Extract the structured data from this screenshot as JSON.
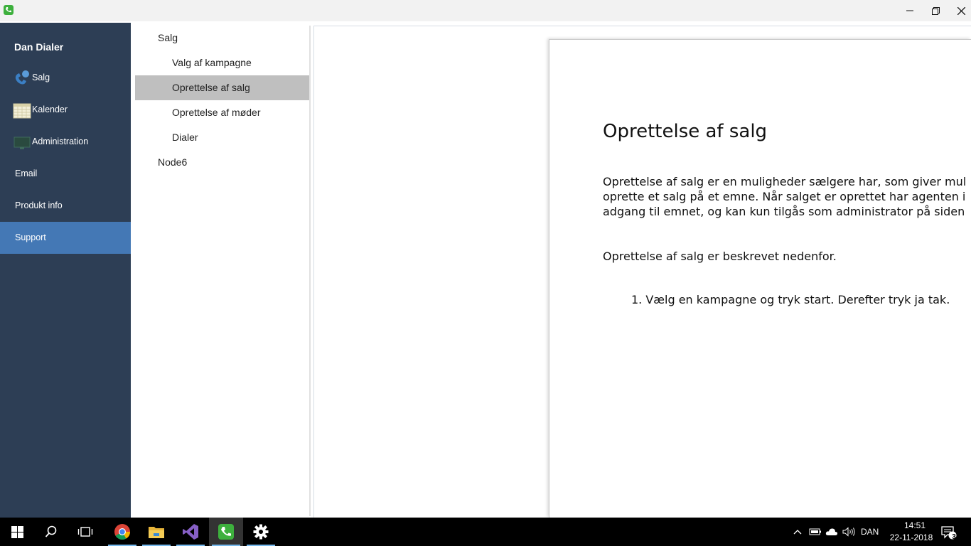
{
  "window": {
    "minimize_glyph": "minimize-icon",
    "maximize_glyph": "restore-icon",
    "close_glyph": "close-icon"
  },
  "sidebar": {
    "title": "Dan Dialer",
    "items": [
      {
        "label": "Salg",
        "icon": "phone-icon"
      },
      {
        "label": "Kalender",
        "icon": "calendar-icon"
      },
      {
        "label": "Administration",
        "icon": "monitor-icon"
      },
      {
        "label": "Email"
      },
      {
        "label": "Produkt info"
      },
      {
        "label": "Support",
        "active": true
      }
    ]
  },
  "tree": {
    "nodes": [
      {
        "label": "Salg",
        "expanded": true
      },
      {
        "label": "Valg af kampagne"
      },
      {
        "label": "Oprettelse af salg",
        "selected": true
      },
      {
        "label": "Oprettelse af møder"
      },
      {
        "label": "Dialer"
      },
      {
        "label": "Node6",
        "expanded": false
      }
    ]
  },
  "document": {
    "heading": "Oprettelse af salg",
    "paragraph_lines": [
      "Oprettelse af salg er en muligheder sælgere har, som giver mul",
      "oprette et salg på et emne. Når salget er oprettet har agenten i",
      "adgang til emnet, og kan kun tilgås som administrator på siden"
    ],
    "intro": "Oprettelse af salg er beskrevet nedenfor.",
    "steps": [
      "1.  Vælg en kampagne og tryk start. Derefter tryk ja tak."
    ]
  },
  "taskbar": {
    "apps": [
      "windows-start-icon",
      "search-icon",
      "task-view-icon",
      "chrome-icon",
      "file-explorer-icon",
      "visual-studio-icon",
      "dan-dialer-icon",
      "settings-icon"
    ],
    "language": "DAN",
    "time": "14:51",
    "date": "22-11-2018",
    "notification_count": "3"
  },
  "colors": {
    "sidebar_bg": "#2d3e55",
    "sidebar_active": "#4478b5",
    "tree_selected": "#bfbfbf",
    "app_green": "#3db03d"
  }
}
